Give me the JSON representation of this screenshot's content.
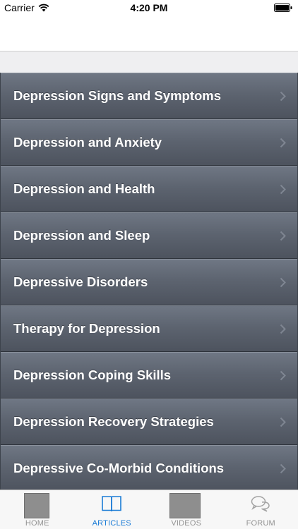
{
  "status_bar": {
    "carrier": "Carrier",
    "time": "4:20 PM",
    "wifi_icon": "wifi-icon",
    "battery_icon": "battery-icon"
  },
  "articles": [
    {
      "label": "Depression Signs and Symptoms"
    },
    {
      "label": "Depression and Anxiety"
    },
    {
      "label": "Depression and Health"
    },
    {
      "label": "Depression and Sleep"
    },
    {
      "label": "Depressive Disorders"
    },
    {
      "label": "Therapy for Depression"
    },
    {
      "label": "Depression Coping Skills"
    },
    {
      "label": "Depression Recovery Strategies"
    },
    {
      "label": "Depressive Co-Morbid Conditions"
    }
  ],
  "tabs": [
    {
      "label": "HOME",
      "icon": "home-thumbnail",
      "active": false
    },
    {
      "label": "ARTICLES",
      "icon": "book-icon",
      "active": true
    },
    {
      "label": "VIDEOS",
      "icon": "videos-thumbnail",
      "active": false
    },
    {
      "label": "FORUM",
      "icon": "chat-bubbles-icon",
      "active": false
    }
  ],
  "colors": {
    "accent": "#1a7bd6",
    "list_item_top": "#6f7784",
    "list_item_bottom": "#4d535e",
    "tab_inactive": "#929292"
  }
}
